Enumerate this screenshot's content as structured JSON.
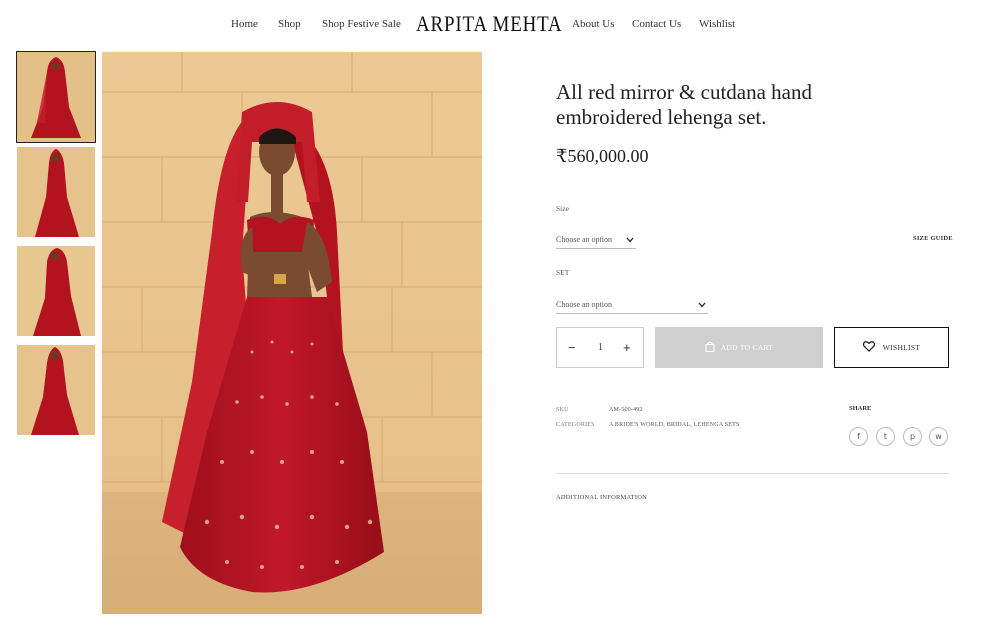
{
  "header": {
    "nav_left": [
      "Home",
      "Shop",
      "Shop Festive Sale"
    ],
    "brand": "ARPITA MEHTA",
    "nav_right": [
      "About Us",
      "Contact Us",
      "Wishlist"
    ]
  },
  "gallery": {
    "thumbnail_count": 4,
    "active_thumbnail": 0
  },
  "product": {
    "title": "All red mirror & cutdana hand embroidered lehenga set.",
    "price": "₹560,000.00",
    "size_label": "Size",
    "size_placeholder": "Choose an option",
    "size_guide": "SIZE GUIDE",
    "set_label": "SET",
    "set_placeholder": "Choose an option",
    "quantity": "1",
    "add_to_cart": "ADD TO CART",
    "wishlist": "WISHLIST",
    "sku_label": "SKU",
    "sku_value": "AM-500-492",
    "categories_label": "CATEGORIES",
    "categories_value": "A BRIDE'S WORLD, BRIDAL, LEHENGA SETS",
    "share_label": "SHARE",
    "additional_information": "ADDITIONAL INFORMATION"
  },
  "icons": {
    "minus": "−",
    "plus": "+",
    "chevron": "⌄",
    "share": [
      "f",
      "t",
      "p",
      "w"
    ]
  },
  "colors": {
    "lehenga_red": "#b3121f",
    "wall": "#e9c68f",
    "button_disabled": "#cfcfcf"
  }
}
